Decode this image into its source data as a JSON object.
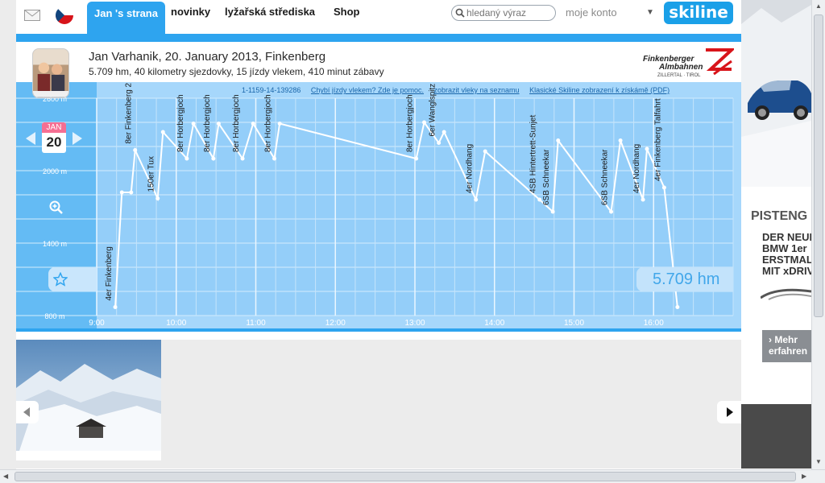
{
  "nav": {
    "tabs": [
      {
        "label": "Jan 's strana",
        "active": true
      },
      {
        "label": "novinky"
      },
      {
        "label": "lyžařská střediska"
      },
      {
        "label": "Shop"
      }
    ],
    "search_placeholder": "hledaný výraz",
    "account": "moje konto",
    "logo": "skiline"
  },
  "profile": {
    "title": "Jan Varhanik, 20. January 2013, Finkenberg",
    "subtitle": "5.709 hm, 40 kilometry sjezdovky, 15 jízdy vlekem, 410 minut zábavy",
    "resort_logo_line1": "Finkenberger",
    "resort_logo_line2": "Almbahnen",
    "resort_logo_line3": "ZILLERTAL · TIROL"
  },
  "chart_links": {
    "code": "1-1159-14-139286",
    "missing": "Chybí jízdy vlekem? Zde je pomoc.",
    "show_list": "zobrazit vleky na seznamu",
    "pdf": "Klasické Skiline zobrazení k získámě (PDF)"
  },
  "date_badge": {
    "month": "JAN",
    "day": "20"
  },
  "total": "5.709 hm",
  "colors": {
    "accent": "#2ea4ef",
    "chart_bg": "#a6d7fb",
    "date_pink": "#f56f93"
  },
  "chart_data": {
    "type": "line",
    "title": "",
    "xlabel": "",
    "ylabel": "",
    "x_ticks": [
      "9:00",
      "10:00",
      "11:00",
      "12:00",
      "13:00",
      "14:00",
      "15:00",
      "16:00"
    ],
    "y_ticks": [
      {
        "label": "2600 m",
        "value": 2600
      },
      {
        "label": "2000 m",
        "value": 2000
      },
      {
        "label": "1400 m",
        "value": 1400
      },
      {
        "label": "800 m",
        "value": 800
      }
    ],
    "xlim": [
      "9:00",
      "17:00"
    ],
    "ylim": [
      800,
      2600
    ],
    "grid": true,
    "series": [
      {
        "points": [
          [
            "9:14",
            870
          ],
          [
            "9:19",
            1820
          ],
          [
            "9:26",
            1820
          ],
          [
            "9:29",
            2170
          ],
          [
            "9:46",
            1770
          ],
          [
            "9:50",
            2320
          ],
          [
            "10:08",
            2100
          ],
          [
            "10:13",
            2390
          ],
          [
            "10:28",
            2100
          ],
          [
            "10:32",
            2390
          ],
          [
            "10:50",
            2100
          ],
          [
            "10:58",
            2390
          ],
          [
            "11:14",
            2100
          ],
          [
            "11:18",
            2390
          ],
          [
            "13:01",
            2100
          ],
          [
            "13:07",
            2400
          ],
          [
            "13:18",
            2230
          ],
          [
            "13:22",
            2320
          ],
          [
            "13:46",
            1760
          ],
          [
            "13:53",
            2160
          ],
          [
            "14:34",
            1760
          ],
          [
            "14:44",
            1660
          ],
          [
            "14:48",
            2250
          ],
          [
            "15:28",
            1660
          ],
          [
            "15:35",
            2250
          ],
          [
            "15:52",
            1760
          ],
          [
            "15:55",
            2180
          ],
          [
            "16:08",
            1860
          ],
          [
            "16:18",
            870
          ]
        ]
      }
    ],
    "annotations": [
      {
        "x": "9:14",
        "text": "4er Finkenberg"
      },
      {
        "x": "9:29",
        "text": "8er Finkenberg 2"
      },
      {
        "x": "9:46",
        "text": "150er Tux"
      },
      {
        "x": "10:08",
        "text": "8er Horbergjoch"
      },
      {
        "x": "10:28",
        "text": "8er Horbergjoch"
      },
      {
        "x": "10:50",
        "text": "8er Horbergjoch"
      },
      {
        "x": "11:14",
        "text": "8er Horbergjoch"
      },
      {
        "x": "13:01",
        "text": "8er Horbergjoch"
      },
      {
        "x": "13:18",
        "text": "6er Wanglspitz"
      },
      {
        "x": "13:46",
        "text": "4er Nordhang"
      },
      {
        "x": "14:34",
        "text": "4SB Hintertrett-Sunjet"
      },
      {
        "x": "14:44",
        "text": "6SB Schneekar"
      },
      {
        "x": "15:28",
        "text": "6SB Schneekar"
      },
      {
        "x": "15:52",
        "text": "4er Nordhang"
      },
      {
        "x": "16:08",
        "text": "4er Finkenberg Talfahrt"
      }
    ]
  },
  "ad": {
    "headline": "PISTENG",
    "lines": [
      "DER NEUE",
      "BMW 1er",
      "ERSTMALS",
      "MIT xDRIV"
    ],
    "button": "› Mehr\nerfahren"
  }
}
